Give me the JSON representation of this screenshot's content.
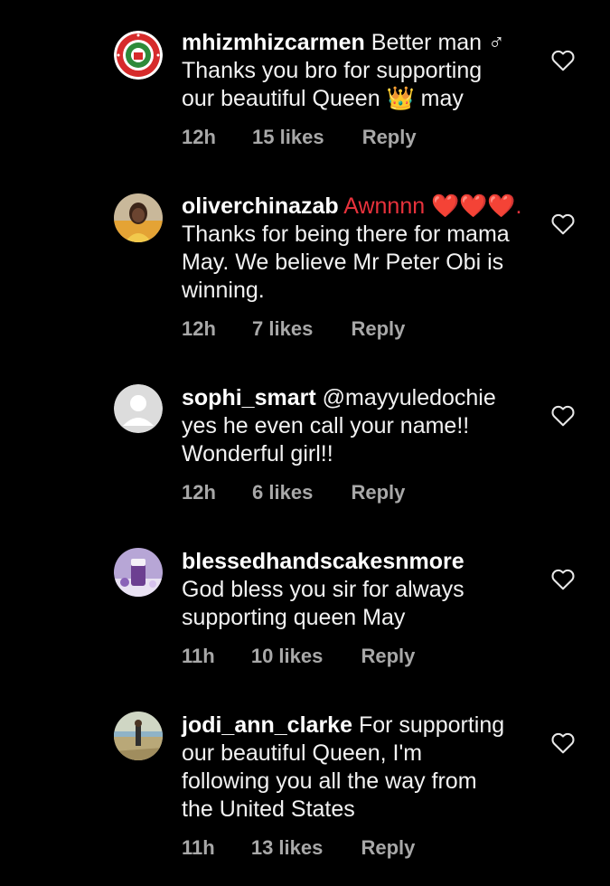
{
  "comments": [
    {
      "username": "mhizmhizcarmen",
      "text_lines": [
        "Better man ♂",
        "Thanks you bro for supporting",
        "our beautiful Queen 👑 may"
      ],
      "time": "12h",
      "likes": "15 likes",
      "reply": "Reply",
      "avatar_icon": "logo-seal-avatar"
    },
    {
      "username": "oliverchinazab",
      "text_lines": [
        "Awnnnn ❤️❤️❤️.",
        "Thanks for being there for mama",
        "May. We believe Mr Peter Obi is",
        "winning."
      ],
      "time": "12h",
      "likes": "7 likes",
      "reply": "Reply",
      "avatar_icon": "person-photo-avatar"
    },
    {
      "username": "sophi_smart",
      "text_lines": [
        "@mayyuledochie",
        "yes he even call your name!!",
        "Wonderful girl!!"
      ],
      "time": "12h",
      "likes": "6 likes",
      "reply": "Reply",
      "avatar_icon": "default-user-avatar"
    },
    {
      "username": "blessedhandscakesnmore",
      "text_lines": [
        "",
        "God bless you sir for always",
        "supporting queen May"
      ],
      "time": "11h",
      "likes": "10 likes",
      "reply": "Reply",
      "avatar_icon": "drink-photo-avatar"
    },
    {
      "username": "jodi_ann_clarke",
      "text_lines": [
        "For supporting",
        "our beautiful Queen, I'm",
        "following you all the way from",
        "the United States"
      ],
      "time": "11h",
      "likes": "13 likes",
      "reply": "Reply",
      "avatar_icon": "beach-photo-avatar"
    }
  ],
  "colors": {
    "background": "#000000",
    "text": "#f2f2f2",
    "meta": "#a8a8a8",
    "heart_emoji": "#e8323c"
  }
}
